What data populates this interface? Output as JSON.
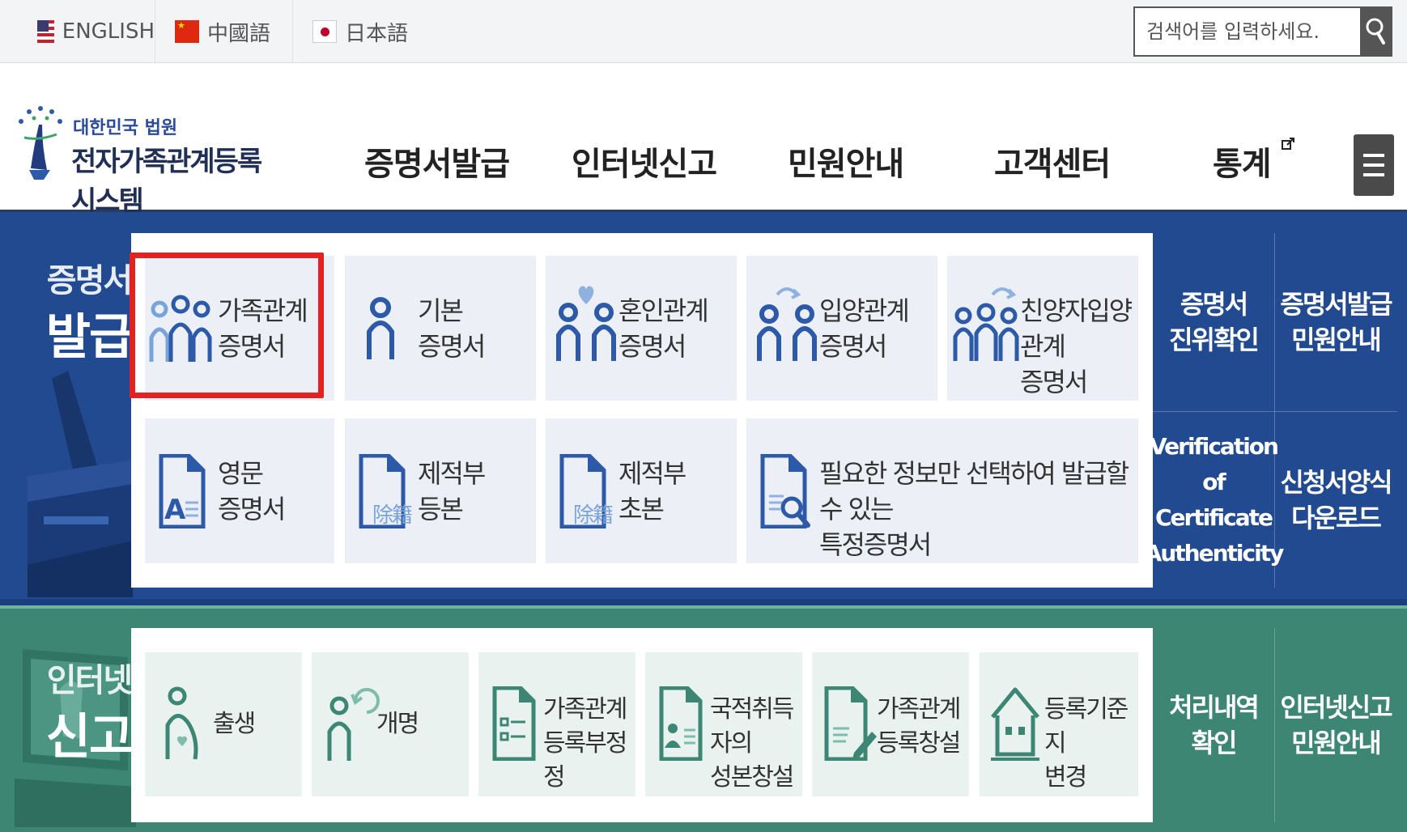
{
  "languages": [
    {
      "label": "ENGLISH",
      "flag": "us-flag"
    },
    {
      "label": "中國語",
      "flag": "cn-flag"
    },
    {
      "label": "日本語",
      "flag": "jp-flag"
    }
  ],
  "search": {
    "placeholder": "검색어를 입력하세요.",
    "button_icon": "search-icon"
  },
  "logo": {
    "sub": "대한민국 법원",
    "main": "전자가족관계등록시스템"
  },
  "nav": [
    {
      "label": "증명서발급"
    },
    {
      "label": "인터넷신고"
    },
    {
      "label": "민원안내"
    },
    {
      "label": "고객센터"
    },
    {
      "label": "통계"
    }
  ],
  "cert": {
    "title_line1": "증명서",
    "title_line2": "발급",
    "tiles": [
      {
        "line1": "가족관계",
        "line2": "증명서",
        "icon": "family-icon"
      },
      {
        "line1": "기본",
        "line2": "증명서",
        "icon": "person-icon"
      },
      {
        "line1": "혼인관계",
        "line2": "증명서",
        "icon": "marriage-icon"
      },
      {
        "line1": "입양관계",
        "line2": "증명서",
        "icon": "adoption-icon"
      },
      {
        "line1": "친양자입양관계",
        "line2": "증명서",
        "icon": "full-adoption-icon"
      },
      {
        "line1": "영문",
        "line2": "증명서",
        "icon": "english-document-icon"
      },
      {
        "line1": "제적부",
        "line2": "등본",
        "icon": "register-document-icon",
        "badge": "除籍"
      },
      {
        "line1": "제적부",
        "line2": "초본",
        "icon": "register-extract-icon",
        "badge": "除籍"
      },
      {
        "line1": "필요한 정보만 선택하여 발급할 수 있는",
        "line2": "특정증명서",
        "icon": "document-search-icon"
      }
    ],
    "side": [
      {
        "line1": "증명서",
        "line2": "진위확인",
        "line3": ""
      },
      {
        "line1": "증명서발급",
        "line2": "민원안내",
        "line3": ""
      },
      {
        "line1": "Verification of",
        "line2": "Certificate",
        "line3": "Authenticity"
      },
      {
        "line1": "신청서양식",
        "line2": "다운로드",
        "line3": ""
      }
    ]
  },
  "net": {
    "title_line1": "인터넷",
    "title_line2": "신고",
    "tiles": [
      {
        "line1": "출생",
        "line2": "",
        "icon": "birth-icon"
      },
      {
        "line1": "개명",
        "line2": "",
        "icon": "rename-icon"
      },
      {
        "line1": "가족관계",
        "line2": "등록부정정",
        "icon": "checklist-document-icon"
      },
      {
        "line1": "국적취득자의",
        "line2": "성본창설",
        "icon": "id-document-icon"
      },
      {
        "line1": "가족관계",
        "line2": "등록창설",
        "icon": "edit-document-icon"
      },
      {
        "line1": "등록기준지",
        "line2": "변경",
        "icon": "house-icon"
      }
    ],
    "side": [
      {
        "line1": "처리내역",
        "line2": "확인"
      },
      {
        "line1": "인터넷신고",
        "line2": "민원안내"
      }
    ]
  },
  "colors": {
    "cert_bg": "#214a90",
    "net_bg": "#3d8674",
    "highlight": "#e32222",
    "icon_blue": "#2c5aa8",
    "icon_green": "#3d8674"
  }
}
